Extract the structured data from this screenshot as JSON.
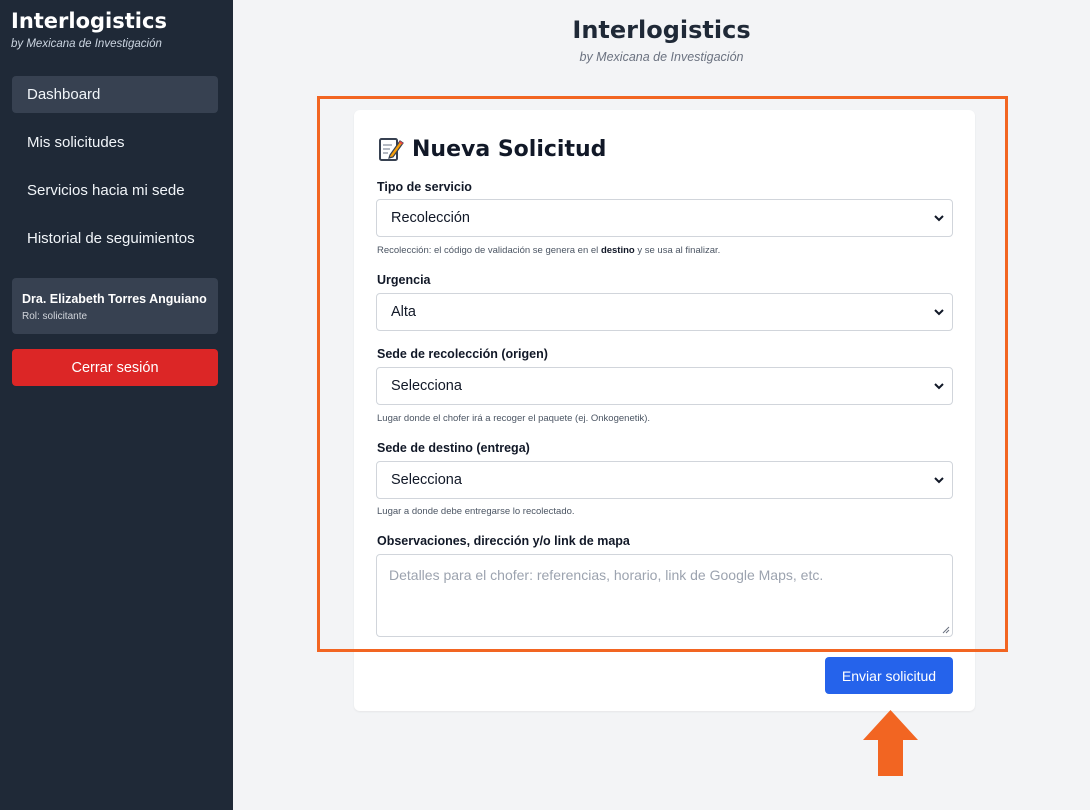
{
  "sidebar": {
    "brand_title": "Interlogistics",
    "brand_subtitle": "by Mexicana de Investigación",
    "items": [
      {
        "label": "Dashboard",
        "active": true
      },
      {
        "label": "Mis solicitudes",
        "active": false
      },
      {
        "label": "Servicios hacia mi sede",
        "active": false
      },
      {
        "label": "Historial de seguimientos",
        "active": false
      }
    ],
    "user": {
      "name": "Dra. Elizabeth Torres Anguiano",
      "role": "Rol: solicitante"
    },
    "logout_label": "Cerrar sesión"
  },
  "header": {
    "title": "Interlogistics",
    "subtitle": "by Mexicana de Investigación"
  },
  "form": {
    "title": "Nueva Solicitud",
    "icon": "memo-icon",
    "tipo_servicio": {
      "label": "Tipo de servicio",
      "value": "Recolección",
      "help_before": "Recolección: el código de validación se genera en el ",
      "help_bold": "destino",
      "help_after": " y se usa al finalizar."
    },
    "urgencia": {
      "label": "Urgencia",
      "value": "Alta"
    },
    "origen": {
      "label": "Sede de recolección (origen)",
      "value": "Selecciona",
      "help": "Lugar donde el chofer irá a recoger el paquete (ej. Onkogenetik)."
    },
    "destino": {
      "label": "Sede de destino (entrega)",
      "value": "Selecciona",
      "help": "Lugar a donde debe entregarse lo recolectado."
    },
    "observaciones": {
      "label": "Observaciones, dirección y/o link de mapa",
      "placeholder": "Detalles para el chofer: referencias, horario, link de Google Maps, etc."
    },
    "submit_label": "Enviar solicitud"
  },
  "colors": {
    "sidebar_bg": "#1f2937",
    "logout": "#dc2626",
    "submit": "#2563eb",
    "highlight": "#f26522"
  }
}
